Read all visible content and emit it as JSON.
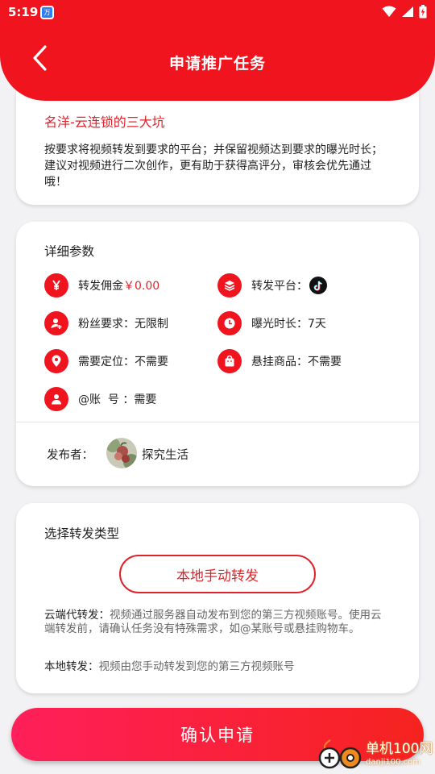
{
  "status_bar": {
    "time": "5:19",
    "app_badge": "万"
  },
  "header": {
    "title": "申请推广任务"
  },
  "task": {
    "name": "名洋-云连锁的三大坑",
    "description": "按要求将视频转发到要求的平台；并保留视频达到要求的曝光时长；建议对视频进行二次创作，更有助于获得高评分，审核会优先通过哦！"
  },
  "params": {
    "title": "详细参数",
    "commission_label": "转发佣金",
    "commission_value": "￥0.00",
    "platform_label": "转发平台：",
    "fans_label": "粉丝要求：",
    "fans_value": "无限制",
    "exposure_label": "曝光时长：",
    "exposure_value": "7天",
    "location_label": "需要定位：",
    "location_value": "不需要",
    "goods_label": "悬挂商品：",
    "goods_value": "不需要",
    "account_label": "@账  号 ：",
    "account_value": "需要",
    "publisher_label": "发布者：",
    "publisher_name": "探究生活"
  },
  "forward_type": {
    "title": "选择转发类型",
    "selected_option": "本地手动转发",
    "cloud_label": "云端代转发：",
    "cloud_desc": "视频通过服务器自动发布到您的第三方视频账号。使用云端转发前，请确认任务没有特殊需求，如@某账号或悬挂购物车。",
    "local_label": "本地转发：",
    "local_desc": "视频由您手动转发到您的第三方视频账号"
  },
  "confirm_button": "确认申请",
  "watermark": {
    "name": "单机100网",
    "url": "danji100.com"
  },
  "colors": {
    "brand_red": "#f0141e",
    "text_red": "#e0232b",
    "background": "#f2f2f4"
  }
}
